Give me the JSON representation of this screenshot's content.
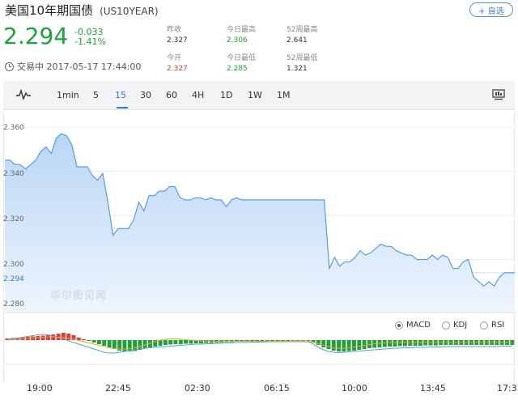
{
  "header": {
    "title": "美国10年期国债",
    "code": "(US10YEAR)",
    "watch_label": "+ 自选"
  },
  "quote": {
    "price": "2.294",
    "change": "-0.033",
    "change_pct": "-1.41%",
    "timestamp": "交易中 2017-05-17 17:44:00"
  },
  "stats": {
    "prev_close_label": "昨收",
    "prev_close": "2.327",
    "open_label": "今开",
    "open": "2.327",
    "high_label": "今日最高",
    "high": "2.306",
    "low_label": "今日最低",
    "low": "2.285",
    "w52_high_label": "52周最高",
    "w52_high": "2.641",
    "w52_low_label": "52周最低",
    "w52_low": "1.321"
  },
  "toolbar": {
    "intervals": [
      "1min",
      "5",
      "15",
      "30",
      "60",
      "4H",
      "1D",
      "1W",
      "1M"
    ],
    "active": "15"
  },
  "indicators": {
    "macd": "MACD",
    "kdj": "KDJ",
    "rsi": "RSI",
    "selected": "MACD"
  },
  "watermark": "华尔街见闻",
  "colors": {
    "up": "#e23a3a",
    "down": "#1da23a",
    "line": "#5b9be6",
    "accent": "#2f7ae5"
  },
  "chart_data": {
    "type": "area",
    "y_ticks": [
      "2.360",
      "2.340",
      "2.320",
      "2.300",
      "2.280"
    ],
    "current_label": "2.294",
    "x_ticks": [
      "19:00",
      "22:45",
      "02:30",
      "06:15",
      "10:00",
      "13:45",
      "17:3"
    ],
    "ylim": [
      2.276,
      2.364
    ],
    "values": [
      2.345,
      2.345,
      2.343,
      2.343,
      2.341,
      2.343,
      2.345,
      2.349,
      2.351,
      2.348,
      2.355,
      2.357,
      2.356,
      2.352,
      2.342,
      2.342,
      2.342,
      2.338,
      2.336,
      2.339,
      2.326,
      2.311,
      2.314,
      2.314,
      2.314,
      2.318,
      2.326,
      2.322,
      2.329,
      2.329,
      2.331,
      2.331,
      2.333,
      2.333,
      2.328,
      2.327,
      2.327,
      2.328,
      2.328,
      2.327,
      2.328,
      2.327,
      2.327,
      2.324,
      2.327,
      2.328,
      2.327,
      2.327,
      2.327,
      2.327,
      2.327,
      2.327,
      2.327,
      2.327,
      2.327,
      2.327,
      2.327,
      2.327,
      2.327,
      2.327,
      2.327,
      2.327,
      2.327,
      2.296,
      2.301,
      2.297,
      2.299,
      2.299,
      2.301,
      2.304,
      2.302,
      2.303,
      2.305,
      2.307,
      2.306,
      2.306,
      2.304,
      2.303,
      2.302,
      2.302,
      2.3,
      2.3,
      2.3,
      2.302,
      2.3,
      2.302,
      2.301,
      2.296,
      2.296,
      2.299,
      2.3,
      2.292,
      2.29,
      2.288,
      2.29,
      2.288,
      2.292,
      2.294,
      2.294,
      2.294
    ],
    "macd_hist": [
      0.2,
      0.25,
      0.3,
      0.35,
      0.4,
      0.45,
      0.5,
      0.55,
      0.6,
      0.7,
      0.8,
      0.9,
      0.8,
      0.6,
      0.3,
      0.1,
      -0.1,
      -0.3,
      -0.5,
      -0.7,
      -0.9,
      -1.1,
      -1.3,
      -1.4,
      -1.4,
      -1.35,
      -1.2,
      -1.05,
      -0.9,
      -0.8,
      -0.7,
      -0.6,
      -0.55,
      -0.5,
      -0.5,
      -0.45,
      -0.45,
      -0.4,
      -0.4,
      -0.35,
      -0.35,
      -0.3,
      -0.3,
      -0.25,
      -0.25,
      -0.2,
      -0.2,
      -0.2,
      -0.15,
      -0.15,
      -0.15,
      -0.1,
      -0.1,
      -0.1,
      -0.1,
      -0.1,
      -0.05,
      -0.05,
      -0.05,
      -0.05,
      -0.3,
      -0.6,
      -0.9,
      -1.1,
      -1.3,
      -1.4,
      -1.4,
      -1.35,
      -1.3,
      -1.2,
      -1.1,
      -1.0,
      -0.95,
      -0.9,
      -0.85,
      -0.8,
      -0.8,
      -0.75,
      -0.75,
      -0.7,
      -0.7,
      -0.7,
      -0.65,
      -0.65,
      -0.65,
      -0.6,
      -0.6,
      -0.6,
      -0.6,
      -0.6,
      -0.6,
      -0.6,
      -0.6,
      -0.6,
      -0.6,
      -0.6,
      -0.6,
      -0.6,
      -0.6,
      -0.6
    ],
    "dif": [
      0.1,
      0.15,
      0.25,
      0.35,
      0.45,
      0.55,
      0.65,
      0.7,
      0.65,
      0.5,
      0.3,
      0.1,
      -0.1,
      -0.3,
      -0.5,
      -0.7,
      -0.9,
      -1.1,
      -1.3,
      -1.5,
      -1.6,
      -1.6,
      -1.5,
      -1.4,
      -1.3,
      -1.2,
      -1.1,
      -1.0,
      -0.95,
      -0.9,
      -0.85,
      -0.8,
      -0.75,
      -0.7,
      -0.65,
      -0.6,
      -0.55,
      -0.5,
      -0.5,
      -0.45,
      -0.45,
      -0.4,
      -0.4,
      -0.35,
      -0.35,
      -0.3,
      -0.3,
      -0.3,
      -0.25,
      -0.25,
      -0.25,
      -0.2,
      -0.2,
      -0.2,
      -0.2,
      -0.2,
      -0.2,
      -0.2,
      -0.2,
      -0.2,
      -0.5,
      -0.9,
      -1.2,
      -1.4,
      -1.5,
      -1.55,
      -1.5,
      -1.45,
      -1.4,
      -1.35,
      -1.3,
      -1.25,
      -1.2,
      -1.15,
      -1.1,
      -1.05,
      -1.0,
      -1.0,
      -0.95,
      -0.95,
      -0.9,
      -0.9,
      -0.9,
      -0.85,
      -0.85,
      -0.85,
      -0.8,
      -0.8,
      -0.8,
      -0.8,
      -0.8,
      -0.8,
      -0.8,
      -0.8,
      -0.8,
      -0.8,
      -0.8,
      -0.75,
      -0.75,
      -0.75
    ],
    "dea": [
      0.0,
      0.05,
      0.1,
      0.15,
      0.2,
      0.25,
      0.3,
      0.35,
      0.4,
      0.4,
      0.35,
      0.3,
      0.2,
      0.1,
      -0.05,
      -0.2,
      -0.35,
      -0.5,
      -0.65,
      -0.8,
      -0.95,
      -1.05,
      -1.1,
      -1.1,
      -1.05,
      -0.95,
      -0.8,
      -0.6,
      -0.4,
      -0.2,
      0.0,
      0.1,
      0.15,
      0.15,
      0.1,
      0.05,
      0.0,
      -0.05,
      -0.1,
      -0.1,
      -0.15,
      -0.15,
      -0.15,
      -0.15,
      -0.15,
      -0.15,
      -0.15,
      -0.15,
      -0.15,
      -0.15,
      -0.15,
      -0.15,
      -0.15,
      -0.15,
      -0.15,
      -0.15,
      -0.15,
      -0.15,
      -0.15,
      -0.15,
      -0.25,
      -0.45,
      -0.65,
      -0.8,
      -0.95,
      -1.0,
      -1.0,
      -0.95,
      -0.85,
      -0.75,
      -0.65,
      -0.55,
      -0.45,
      -0.4,
      -0.35,
      -0.3,
      -0.3,
      -0.3,
      -0.3,
      -0.3,
      -0.3,
      -0.3,
      -0.3,
      -0.3,
      -0.3,
      -0.3,
      -0.3,
      -0.3,
      -0.3,
      -0.3,
      -0.3,
      -0.3,
      -0.3,
      -0.3,
      -0.3,
      -0.3,
      -0.3,
      -0.3,
      -0.3,
      -0.3
    ]
  }
}
